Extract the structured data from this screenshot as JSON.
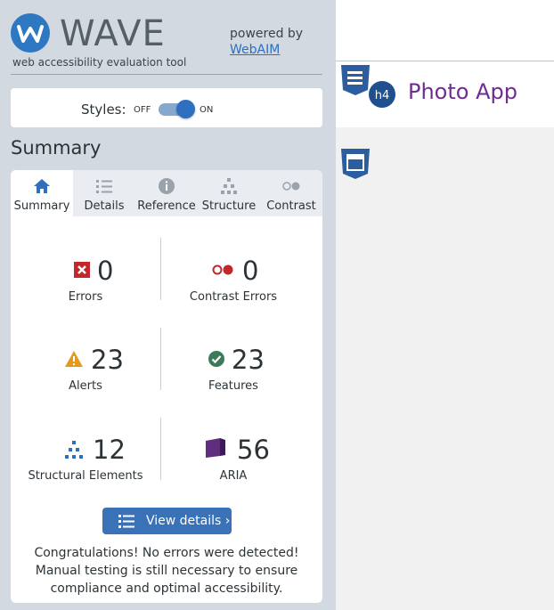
{
  "header": {
    "logo_text": "WAVE",
    "tagline": "web accessibility evaluation tool",
    "powered_by": "powered by",
    "webaim_link": "WebAIM"
  },
  "styles_toggle": {
    "label": "Styles:",
    "off_label": "OFF",
    "on_label": "ON",
    "state": "on"
  },
  "summary": {
    "title": "Summary"
  },
  "tabs": [
    {
      "label": "Summary",
      "icon": "home-icon",
      "active": true
    },
    {
      "label": "Details",
      "icon": "list-icon",
      "active": false
    },
    {
      "label": "Reference",
      "icon": "info-icon",
      "active": false
    },
    {
      "label": "Structure",
      "icon": "structure-icon",
      "active": false
    },
    {
      "label": "Contrast",
      "icon": "contrast-icon",
      "active": false
    }
  ],
  "stats": {
    "errors": {
      "value": "0",
      "label": "Errors",
      "icon": "error-icon",
      "color": "#c0282b"
    },
    "contrast_errors": {
      "value": "0",
      "label": "Contrast Errors",
      "icon": "contrast-error-icon",
      "color": "#c0282b"
    },
    "alerts": {
      "value": "23",
      "label": "Alerts",
      "icon": "alert-icon",
      "color": "#e49a1c"
    },
    "features": {
      "value": "23",
      "label": "Features",
      "icon": "feature-check-icon",
      "color": "#3d7a5c"
    },
    "structural": {
      "value": "12",
      "label": "Structural Elements",
      "icon": "structural-elements-icon",
      "color": "#2e6fbf"
    },
    "aria": {
      "value": "56",
      "label": "ARIA",
      "icon": "aria-icon",
      "color": "#5e2d7d"
    }
  },
  "view_details_button": "View details ›",
  "congrats_message": "Congratulations! No errors were detected! Manual testing is still necessary to ensure compliance and optimal accessibility.",
  "page": {
    "heading_tag": "h4",
    "app_title": "Photo App",
    "brand_color": "#6e2d8f"
  }
}
